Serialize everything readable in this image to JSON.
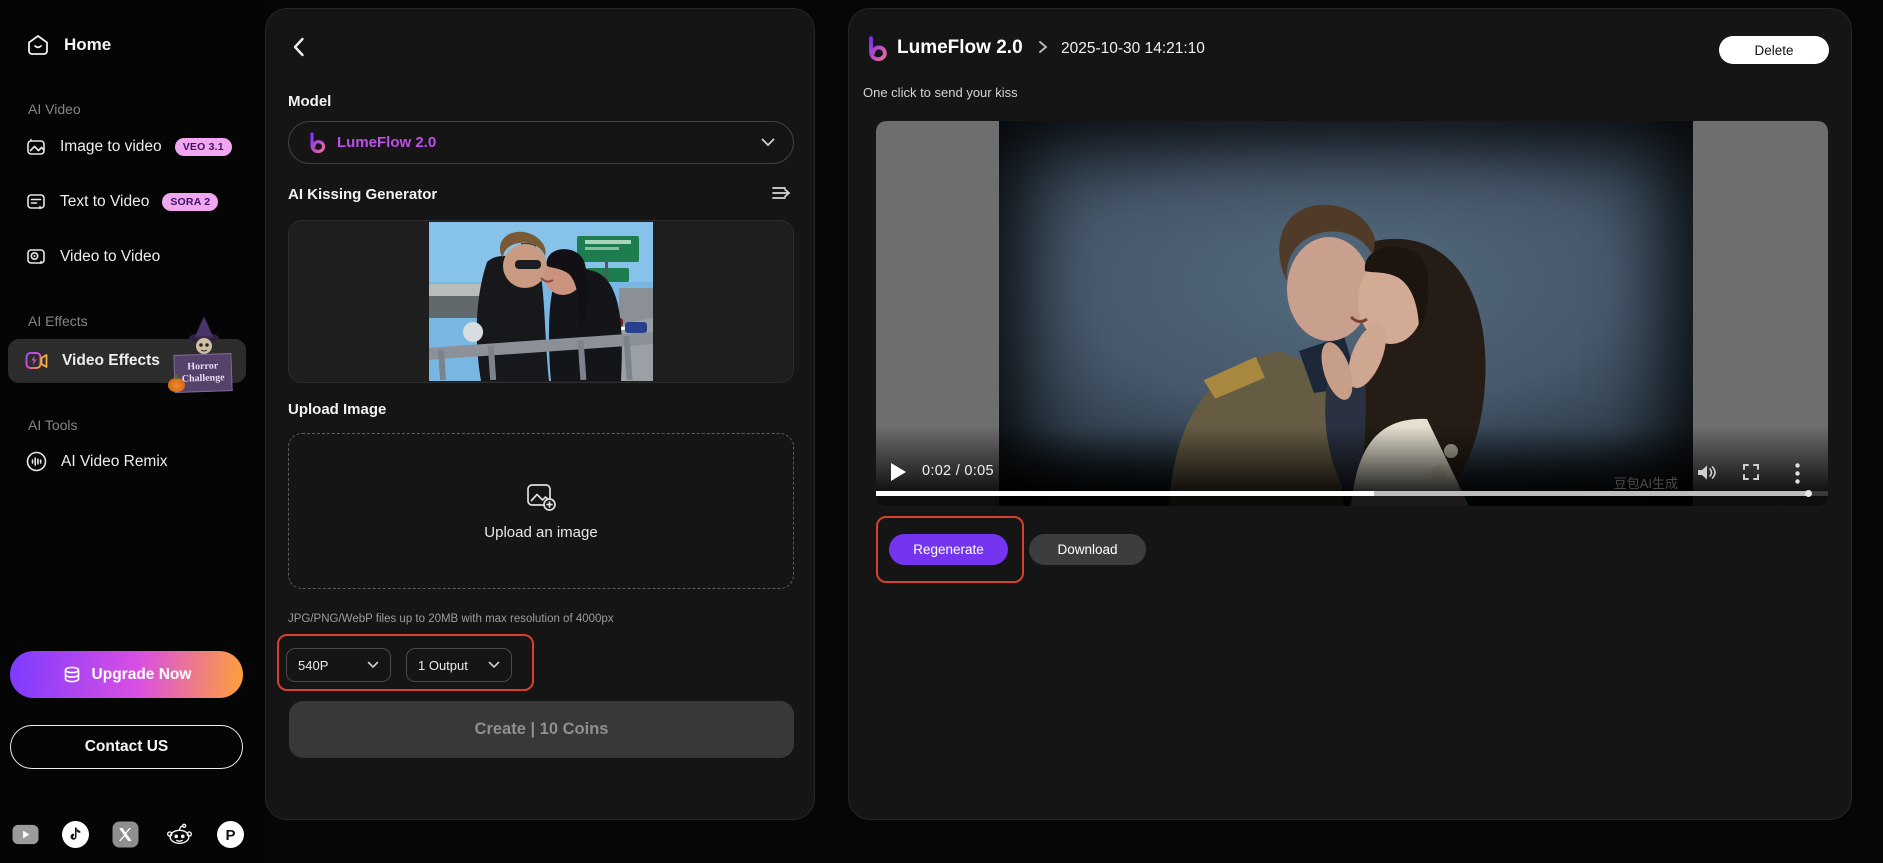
{
  "sidebar": {
    "home_label": "Home",
    "sections": [
      {
        "label": "AI Video",
        "items": [
          {
            "label": "Image to video",
            "badge": "VEO 3.1"
          },
          {
            "label": "Text to Video",
            "badge": "SORA 2"
          },
          {
            "label": "Video to Video"
          }
        ]
      },
      {
        "label": "AI Effects",
        "items": [
          {
            "label": "Video Effects",
            "sticker": "Horror Challenge"
          }
        ]
      },
      {
        "label": "AI Tools",
        "items": [
          {
            "label": "AI Video Remix"
          }
        ]
      }
    ],
    "upgrade_label": "Upgrade Now",
    "contact_label": "Contact US",
    "social_icons": [
      "youtube",
      "tiktok",
      "x",
      "reddit",
      "p-circle"
    ]
  },
  "composer": {
    "model_label": "Model",
    "model_value": "LumeFlow 2.0",
    "generator_title": "AI Kissing Generator",
    "upload_label": "Upload Image",
    "upload_placeholder": "Upload an image",
    "upload_hint": "JPG/PNG/WebP files up to 20MB with max resolution of 4000px",
    "resolution_value": "540P",
    "output_value": "1 Output",
    "create_label": "Create | 10 Coins"
  },
  "result": {
    "model_name": "LumeFlow 2.0",
    "breadcrumb_separator": "›",
    "timestamp": "2025-10-30 14:21:10",
    "delete_label": "Delete",
    "prompt": "One click to send your kiss",
    "player": {
      "time_display": "0:02 / 0:05",
      "watermark": "豆包AI生成"
    },
    "regenerate_label": "Regenerate",
    "download_label": "Download"
  },
  "colors": {
    "accent_purple": "#7434f0",
    "annotation_red": "#d6402c",
    "badge_pink": "#f0a7ef",
    "model_text": "#bb4fe8",
    "upgrade_gradient": [
      "#7d3bff",
      "#d94fe3",
      "#ffa038"
    ]
  }
}
